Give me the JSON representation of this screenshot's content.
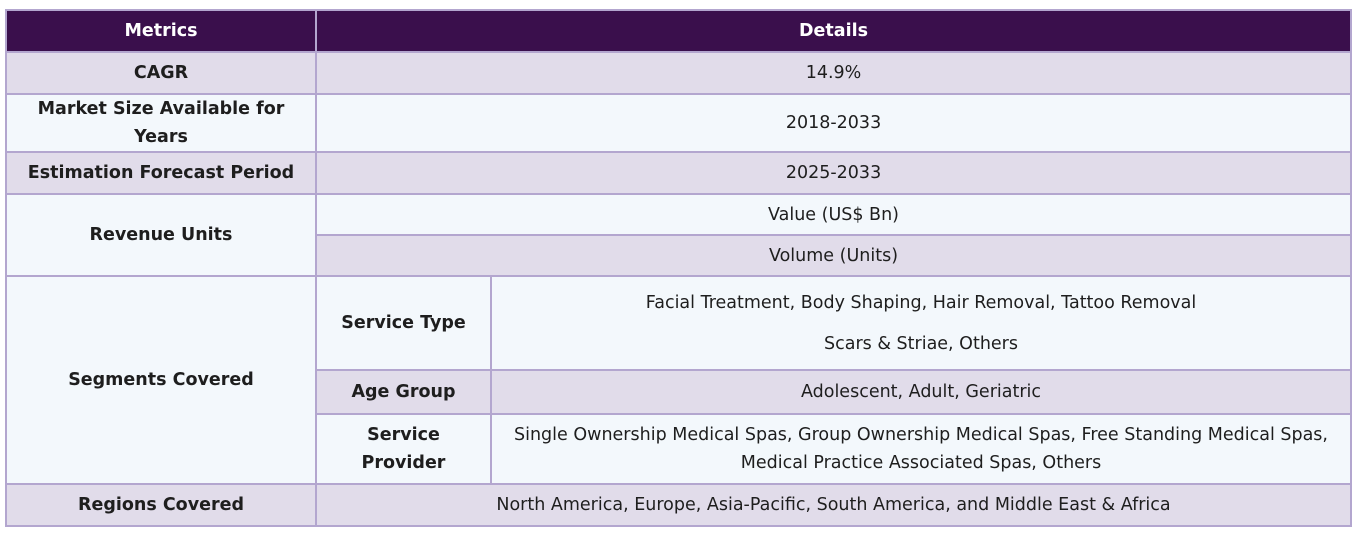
{
  "header": {
    "metrics": "Metrics",
    "details": "Details"
  },
  "rows": {
    "cagr": {
      "label": "CAGR",
      "value": "14.9%"
    },
    "market_size": {
      "label": "Market Size Available for Years",
      "value": "2018-2033"
    },
    "forecast": {
      "label": "Estimation Forecast Period",
      "value": "2025-2033"
    },
    "revenue_units": {
      "label": "Revenue Units",
      "value_1": "Value (US$ Bn)",
      "value_2": "Volume (Units)"
    },
    "segments": {
      "label": "Segments Covered",
      "service_type": {
        "label": "Service Type",
        "line_1": "Facial Treatment, Body Shaping, Hair Removal, Tattoo Removal",
        "line_2": "Scars & Striae, Others"
      },
      "age_group": {
        "label": "Age Group",
        "value": "Adolescent, Adult, Geriatric"
      },
      "service_provider": {
        "label": "Service Provider",
        "line_1": "Single Ownership Medical Spas, Group Ownership Medical Spas, Free Standing Medical Spas,",
        "line_2": "Medical Practice Associated Spas, Others"
      }
    },
    "regions": {
      "label": "Regions Covered",
      "value": "North America, Europe, Asia-Pacific, South America, and Middle East & Africa"
    }
  },
  "colors": {
    "header_bg": "#3a0f4c",
    "row_shaded": "#e1dcea",
    "row_light": "#f3f8fc",
    "border": "#b3a6cf"
  }
}
